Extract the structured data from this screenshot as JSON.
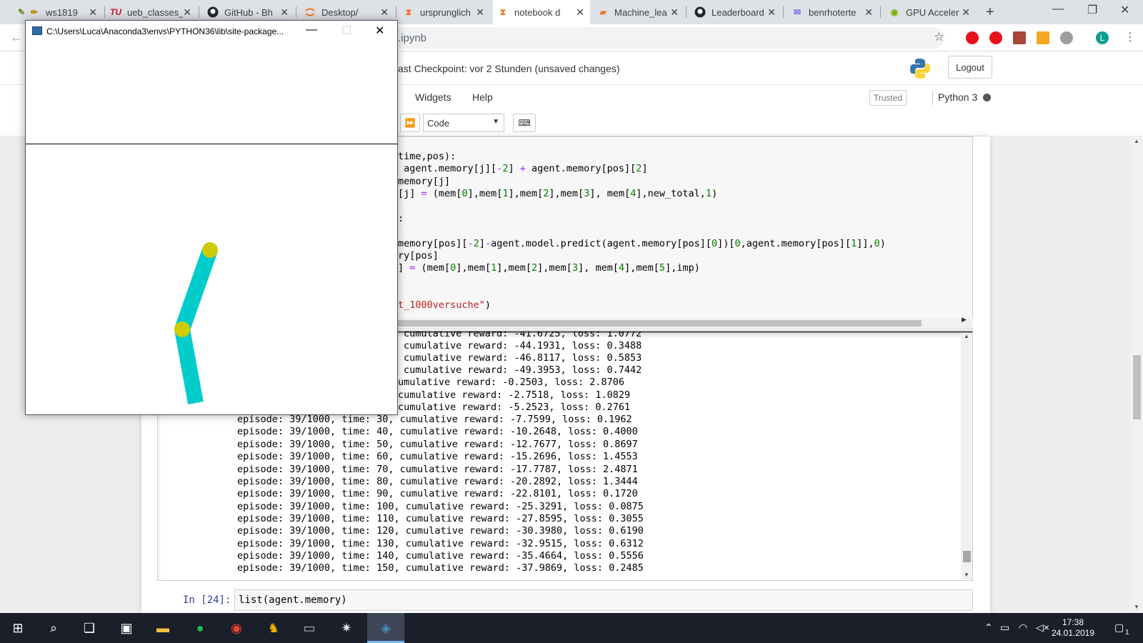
{
  "browser": {
    "tabs": [
      {
        "icon": "notebook-pencil-icon",
        "title": "ws1819",
        "active": false
      },
      {
        "icon": "tu-logo-icon",
        "title": "ueb_classes_",
        "active": false
      },
      {
        "icon": "github-icon",
        "title": "GitHub - Bh",
        "active": false
      },
      {
        "icon": "jupyter-icon",
        "title": "Desktop/",
        "active": false
      },
      {
        "icon": "jupyter-hourglass-icon",
        "title": "ursprunglich",
        "active": false
      },
      {
        "icon": "jupyter-hourglass-icon",
        "title": "notebook d",
        "active": true
      },
      {
        "icon": "book-icon",
        "title": "Machine_lea",
        "active": false
      },
      {
        "icon": "github-icon",
        "title": "Leaderboard",
        "active": false
      },
      {
        "icon": "mail-icon",
        "title": "benrhoterte",
        "active": false
      },
      {
        "icon": "nvidia-icon",
        "title": "GPU Acceler",
        "active": false
      }
    ],
    "new_tab": "+",
    "url": ".ipynb",
    "profile_initial": "L"
  },
  "jupyter": {
    "checkpoint": "ast Checkpoint: vor 2 Stunden  (unsaved changes)",
    "logout": "Logout",
    "menu": [
      "Widgets",
      "Help"
    ],
    "trusted": "Trusted",
    "kernel": "Python 3",
    "cell_type": "Code"
  },
  "code_lines": [
    {
      "text": "time,pos):"
    },
    {
      "text": " agent.memory[j][-2] + agent.memory[pos][2]"
    },
    {
      "text": "memory[j]"
    },
    {
      "text": "[j] = (mem[0],mem[1],mem[2],mem[3], mem[4],new_total,1)"
    },
    {
      "text": ""
    },
    {
      "text": ":"
    },
    {
      "text": ""
    },
    {
      "text": "memory[pos][-2]-agent.model.predict(agent.memory[pos][0])[0,agent.memory[pos][1]],0)"
    },
    {
      "text": "ry[pos]"
    },
    {
      "text": "] = (mem[0],mem[1],mem[2],mem[3], mem[4],mem[5],imp)"
    },
    {
      "text": ""
    },
    {
      "text": ""
    },
    {
      "text": "t_1000versuche\")"
    }
  ],
  "output_lines_hidden": [
    "cumulative reward: -41.6725, loss: 1.0772",
    "cumulative reward: -44.1931, loss: 0.3488",
    "cumulative reward: -46.8117, loss: 0.5853",
    "cumulative reward: -49.3953, loss: 0.7442",
    "umulative reward: -0.2503, loss: 2.8706",
    "cumulative reward: -2.7518, loss: 1.0829",
    "cumulative reward: -5.2523, loss: 0.2761"
  ],
  "output_lines": [
    "episode: 39/1000, time: 30, cumulative reward: -7.7599, loss: 0.1962",
    "episode: 39/1000, time: 40, cumulative reward: -10.2648, loss: 0.4000",
    "episode: 39/1000, time: 50, cumulative reward: -12.7677, loss: 0.8697",
    "episode: 39/1000, time: 60, cumulative reward: -15.2696, loss: 1.4553",
    "episode: 39/1000, time: 70, cumulative reward: -17.7787, loss: 2.4871",
    "episode: 39/1000, time: 80, cumulative reward: -20.2892, loss: 1.3444",
    "episode: 39/1000, time: 90, cumulative reward: -22.8101, loss: 0.1720",
    "episode: 39/1000, time: 100, cumulative reward: -25.3291, loss: 0.0875",
    "episode: 39/1000, time: 110, cumulative reward: -27.8595, loss: 0.3055",
    "episode: 39/1000, time: 120, cumulative reward: -30.3980, loss: 0.6190",
    "episode: 39/1000, time: 130, cumulative reward: -32.9515, loss: 0.6312",
    "episode: 39/1000, time: 140, cumulative reward: -35.4664, loss: 0.5556",
    "episode: 39/1000, time: 150, cumulative reward: -37.9869, loss: 0.2485"
  ],
  "next_cell": {
    "prompt": "In [24]:",
    "code": "list(agent.memory)"
  },
  "pygame_window": {
    "title": "C:\\Users\\Luca\\Anaconda3\\envs\\PYTHON36\\lib\\site-package...",
    "link_color": "#00cccc",
    "joint_color": "#cccc00"
  },
  "taskbar": {
    "time": "17:38",
    "date": "24.01.2019",
    "notification_count": "1"
  }
}
